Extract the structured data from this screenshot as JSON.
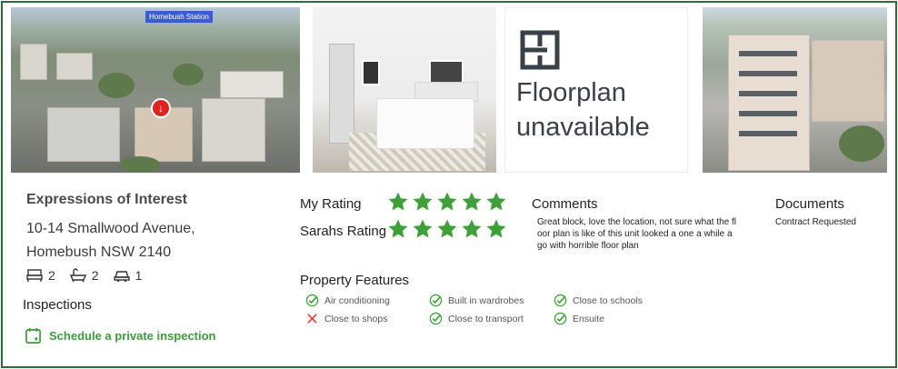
{
  "photos": {
    "aerial_tag": "Homebush Station",
    "floorplan_text": [
      "Floorplan",
      "unavailable"
    ]
  },
  "listing": {
    "title": "Expressions of Interest",
    "address_line1": "10-14 Smallwood Avenue,",
    "address_line2": "Homebush NSW 2140",
    "beds": "2",
    "baths": "2",
    "cars": "1"
  },
  "inspections": {
    "heading": "Inspections",
    "schedule_label": "Schedule a private inspection"
  },
  "ratings": {
    "my_label": "My Rating",
    "my_value": 5,
    "sarah_label": "Sarahs Rating",
    "sarah_value": 5,
    "max": 5
  },
  "comments": {
    "heading": "Comments",
    "text": "Great block, love the location, not sure what the floor plan is like of this unit looked a one a while ago with horrible floor plan"
  },
  "documents": {
    "heading": "Documents",
    "item": "Contract Requested"
  },
  "features": {
    "heading": "Property Features",
    "items": [
      {
        "label": "Air conditioning",
        "has": true
      },
      {
        "label": "Close to shops",
        "has": false
      },
      {
        "label": "Built in wardrobes",
        "has": true
      },
      {
        "label": "Close to transport",
        "has": true
      },
      {
        "label": "Close to schools",
        "has": true
      },
      {
        "label": "Ensuite",
        "has": true
      }
    ]
  },
  "colors": {
    "accent_green": "#3d9a3c",
    "star_green": "#3fa03a",
    "cross_red": "#e03a3a",
    "frame": "#2f6b3a"
  }
}
